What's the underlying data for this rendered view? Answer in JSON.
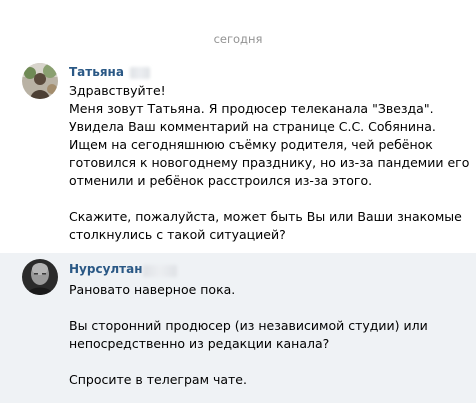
{
  "chat": {
    "date_separator": "сегодня",
    "messages": [
      {
        "author": "Татьяна",
        "lines": [
          "Здравствуйте!",
          "Меня зовут Татьяна. Я продюсер телеканала \"Звезда\".",
          "Увидела Ваш комментарий на странице С.С. Собянина.",
          "Ищем на сегодняшнюю съёмку родителя, чей ребёнок",
          "готовился к новогоднему празднику, но из-за пандемии его",
          "отменили и ребёнок расстроился из-за этого.",
          "",
          "Скажите, пожалуйста, может быть Вы или Ваши знакомые",
          "столкнулись с такой ситуацией?"
        ]
      },
      {
        "author": "Нурсултан",
        "lines": [
          "Рановато наверное пока.",
          "",
          "Вы сторонний продюсер (из независимой студии) или",
          "непосредственно из редакции канала?",
          "",
          "Спросите в телеграм чате."
        ]
      }
    ]
  },
  "colors": {
    "author_name": "#2a5885",
    "date_separator": "#939393",
    "highlighted_background": "#eff2f5"
  }
}
